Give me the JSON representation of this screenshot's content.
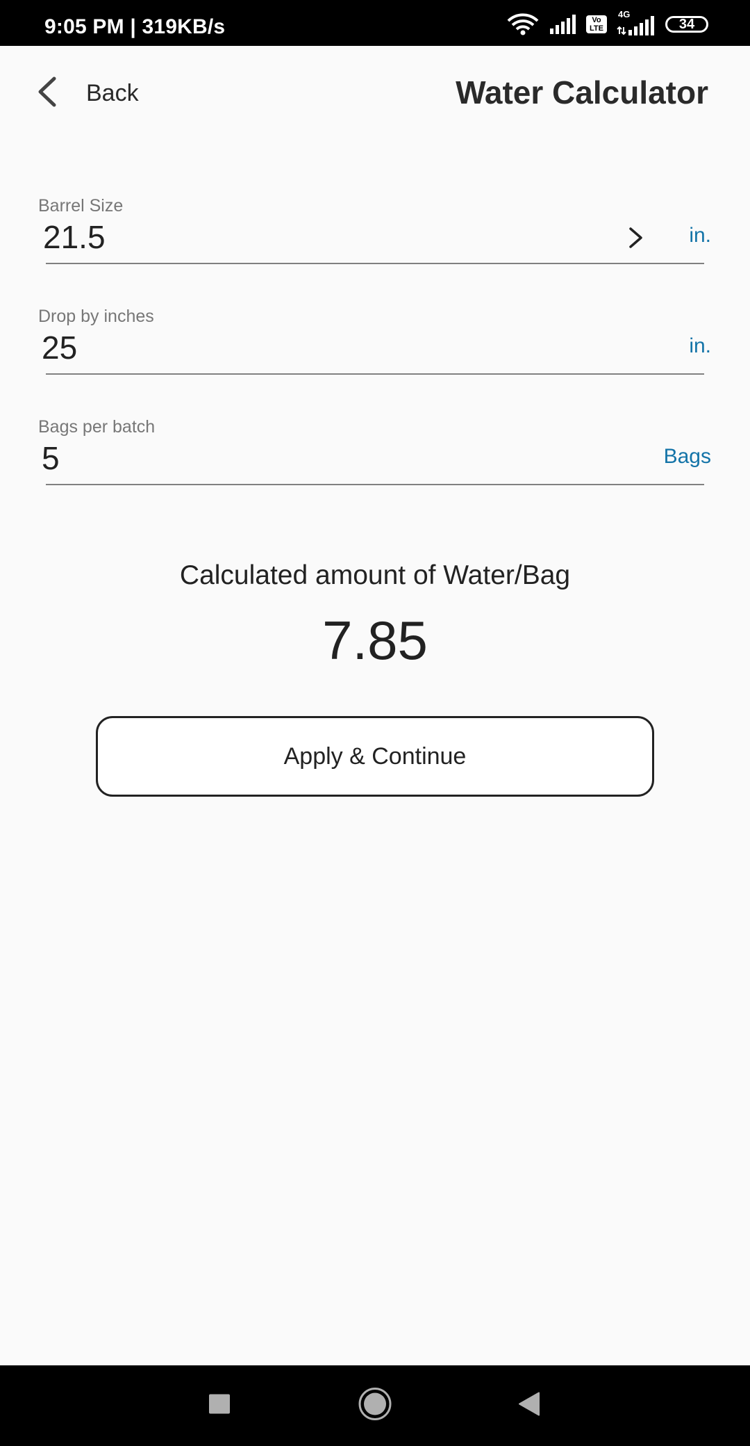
{
  "status_bar": {
    "time_and_speed": "9:05 PM | 319KB/s",
    "volte_line1": "Vo",
    "volte_line2": "LTE",
    "network_label": "4G",
    "battery": "34"
  },
  "header": {
    "back_label": "Back",
    "title": "Water Calculator"
  },
  "fields": [
    {
      "label": "Barrel Size",
      "value": "21.5",
      "unit": "in.",
      "has_chevron": true
    },
    {
      "label": "Drop by inches",
      "value": "25",
      "unit": "in."
    },
    {
      "label": "Bags per batch",
      "value": "5",
      "unit": "Bags"
    }
  ],
  "result": {
    "label": "Calculated amount of Water/Bag",
    "value": "7.85"
  },
  "actions": {
    "apply_label": "Apply & Continue"
  },
  "colors": {
    "accent": "#1474a8",
    "background": "#fafafa",
    "text": "#222222"
  }
}
